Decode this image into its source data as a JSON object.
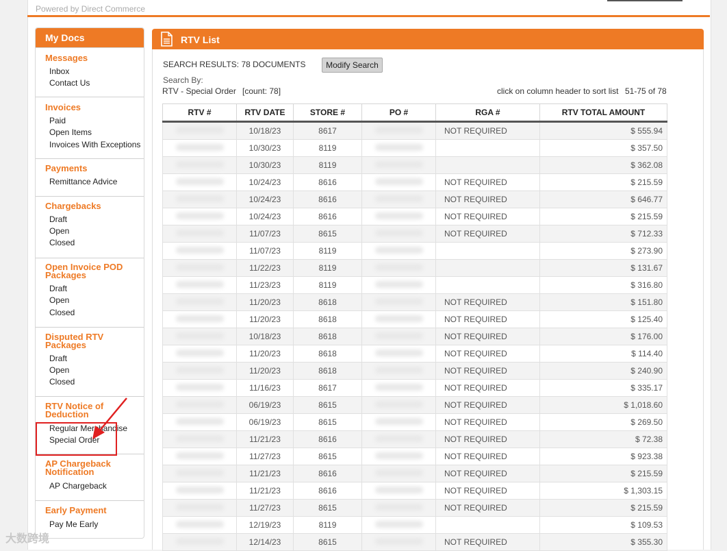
{
  "powered_by": "Powered by Direct Commerce",
  "sidebar": {
    "title": "My Docs",
    "sections": [
      {
        "title": [
          "Messages"
        ],
        "items": [
          "Inbox",
          "Contact Us"
        ]
      },
      {
        "title": [
          "Invoices"
        ],
        "items": [
          "Paid",
          "Open Items",
          "Invoices With Exceptions"
        ]
      },
      {
        "title": [
          "Payments"
        ],
        "items": [
          "Remittance Advice"
        ]
      },
      {
        "title": [
          "Chargebacks"
        ],
        "items": [
          "Draft",
          "Open",
          "Closed"
        ]
      },
      {
        "title": [
          "Open Invoice POD",
          "Packages"
        ],
        "items": [
          "Draft",
          "Open",
          "Closed"
        ]
      },
      {
        "title": [
          "Disputed RTV",
          "Packages"
        ],
        "items": [
          "Draft",
          "Open",
          "Closed"
        ]
      },
      {
        "title": [
          "RTV Notice of",
          "Deduction"
        ],
        "items": [
          "Regular Merchandise",
          "Special Order"
        ]
      },
      {
        "title": [
          "AP Chargeback",
          "Notification"
        ],
        "items": [
          "AP Chargeback"
        ]
      },
      {
        "title": [
          "Early Payment"
        ],
        "items": [
          "Pay Me Early"
        ]
      }
    ]
  },
  "panel": {
    "title": "RTV List",
    "search_results_label": "SEARCH RESULTS:  78 DOCUMENTS",
    "modify_button": "Modify Search",
    "search_by_label": "Search By:",
    "rtv_type": "RTV - Special Order",
    "count": "[count: 78]",
    "sort_hint": "click on column header to sort list",
    "range": "51-75 of 78"
  },
  "table": {
    "headers": [
      "RTV #",
      "RTV DATE",
      "STORE #",
      "PO #",
      "RGA #",
      "RTV TOTAL AMOUNT"
    ],
    "rows": [
      {
        "date": "10/18/23",
        "store": "8617",
        "rga": "NOT REQUIRED",
        "amount": "$ 555.94"
      },
      {
        "date": "10/30/23",
        "store": "8119",
        "rga": "",
        "amount": "$ 357.50"
      },
      {
        "date": "10/30/23",
        "store": "8119",
        "rga": "",
        "amount": "$ 362.08"
      },
      {
        "date": "10/24/23",
        "store": "8616",
        "rga": "NOT REQUIRED",
        "amount": "$ 215.59"
      },
      {
        "date": "10/24/23",
        "store": "8616",
        "rga": "NOT REQUIRED",
        "amount": "$ 646.77"
      },
      {
        "date": "10/24/23",
        "store": "8616",
        "rga": "NOT REQUIRED",
        "amount": "$ 215.59"
      },
      {
        "date": "11/07/23",
        "store": "8615",
        "rga": "NOT REQUIRED",
        "amount": "$ 712.33"
      },
      {
        "date": "11/07/23",
        "store": "8119",
        "rga": "",
        "amount": "$ 273.90"
      },
      {
        "date": "11/22/23",
        "store": "8119",
        "rga": "",
        "amount": "$ 131.67"
      },
      {
        "date": "11/23/23",
        "store": "8119",
        "rga": "",
        "amount": "$ 316.80"
      },
      {
        "date": "11/20/23",
        "store": "8618",
        "rga": "NOT REQUIRED",
        "amount": "$ 151.80"
      },
      {
        "date": "11/20/23",
        "store": "8618",
        "rga": "NOT REQUIRED",
        "amount": "$ 125.40"
      },
      {
        "date": "10/18/23",
        "store": "8618",
        "rga": "NOT REQUIRED",
        "amount": "$ 176.00"
      },
      {
        "date": "11/20/23",
        "store": "8618",
        "rga": "NOT REQUIRED",
        "amount": "$ 114.40"
      },
      {
        "date": "11/20/23",
        "store": "8618",
        "rga": "NOT REQUIRED",
        "amount": "$ 240.90"
      },
      {
        "date": "11/16/23",
        "store": "8617",
        "rga": "NOT REQUIRED",
        "amount": "$ 335.17"
      },
      {
        "date": "06/19/23",
        "store": "8615",
        "rga": "NOT REQUIRED",
        "amount": "$ 1,018.60"
      },
      {
        "date": "06/19/23",
        "store": "8615",
        "rga": "NOT REQUIRED",
        "amount": "$ 269.50"
      },
      {
        "date": "11/21/23",
        "store": "8616",
        "rga": "NOT REQUIRED",
        "amount": "$ 72.38"
      },
      {
        "date": "11/27/23",
        "store": "8615",
        "rga": "NOT REQUIRED",
        "amount": "$ 923.38"
      },
      {
        "date": "11/21/23",
        "store": "8616",
        "rga": "NOT REQUIRED",
        "amount": "$ 215.59"
      },
      {
        "date": "11/21/23",
        "store": "8616",
        "rga": "NOT REQUIRED",
        "amount": "$ 1,303.15"
      },
      {
        "date": "11/27/23",
        "store": "8615",
        "rga": "NOT REQUIRED",
        "amount": "$ 215.59"
      },
      {
        "date": "12/19/23",
        "store": "8119",
        "rga": "",
        "amount": "$ 109.53"
      },
      {
        "date": "12/14/23",
        "store": "8615",
        "rga": "NOT REQUIRED",
        "amount": "$ 355.30"
      }
    ]
  },
  "watermark": "大数跨境",
  "colors": {
    "accent": "#ee7a25",
    "annotation": "#e02020"
  },
  "icons": {
    "panel": "document-icon",
    "annotation": "red-arrow"
  }
}
